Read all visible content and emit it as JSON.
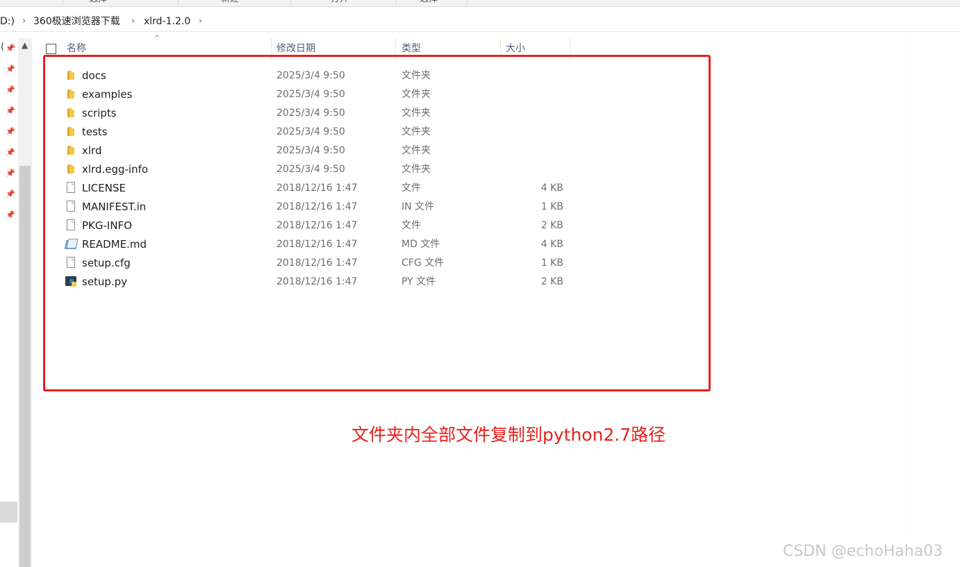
{
  "ribbon": {
    "labels": [
      "选择",
      "新建",
      "打开",
      "选择"
    ]
  },
  "address": {
    "crumbs": [
      "D:)",
      "360极速浏览器下载",
      "xlrd-1.2.0"
    ]
  },
  "nav": {
    "partial_glyph": "("
  },
  "columns": {
    "name": "名称",
    "date": "修改日期",
    "type": "类型",
    "size": "大小"
  },
  "files": [
    {
      "name": "docs",
      "date": "2025/3/4 9:50",
      "type": "文件夹",
      "size": "",
      "icon": "folder-icon"
    },
    {
      "name": "examples",
      "date": "2025/3/4 9:50",
      "type": "文件夹",
      "size": "",
      "icon": "folder-icon"
    },
    {
      "name": "scripts",
      "date": "2025/3/4 9:50",
      "type": "文件夹",
      "size": "",
      "icon": "folder-icon"
    },
    {
      "name": "tests",
      "date": "2025/3/4 9:50",
      "type": "文件夹",
      "size": "",
      "icon": "folder-icon"
    },
    {
      "name": "xlrd",
      "date": "2025/3/4 9:50",
      "type": "文件夹",
      "size": "",
      "icon": "folder-icon"
    },
    {
      "name": "xlrd.egg-info",
      "date": "2025/3/4 9:50",
      "type": "文件夹",
      "size": "",
      "icon": "folder-icon"
    },
    {
      "name": "LICENSE",
      "date": "2018/12/16 1:47",
      "type": "文件",
      "size": "4 KB",
      "icon": "file-icon"
    },
    {
      "name": "MANIFEST.in",
      "date": "2018/12/16 1:47",
      "type": "IN 文件",
      "size": "1 KB",
      "icon": "file-icon"
    },
    {
      "name": "PKG-INFO",
      "date": "2018/12/16 1:47",
      "type": "文件",
      "size": "2 KB",
      "icon": "file-icon"
    },
    {
      "name": "README.md",
      "date": "2018/12/16 1:47",
      "type": "MD 文件",
      "size": "4 KB",
      "icon": "markdown-file-icon"
    },
    {
      "name": "setup.cfg",
      "date": "2018/12/16 1:47",
      "type": "CFG 文件",
      "size": "1 KB",
      "icon": "file-icon"
    },
    {
      "name": "setup.py",
      "date": "2018/12/16 1:47",
      "type": "PY 文件",
      "size": "2 KB",
      "icon": "python-file-icon"
    }
  ],
  "annotation": "文件夹内全部文件复制到python2.7路径",
  "watermark": "CSDN @echoHaha03",
  "colors": {
    "annotation": "#e8201d",
    "folder": "#f7c948"
  }
}
